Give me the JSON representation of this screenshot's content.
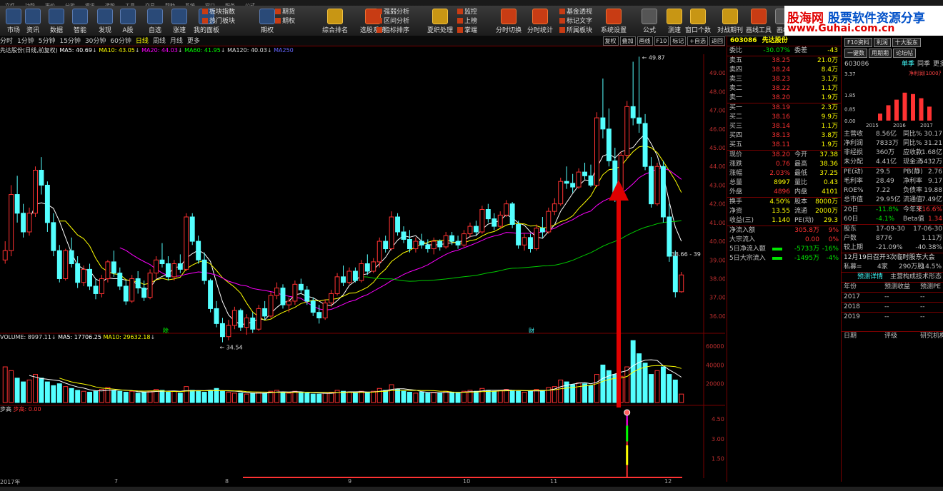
{
  "menubar": {
    "items": [
      "文件",
      "功能",
      "报价",
      "分析",
      "资讯",
      "选股",
      "工具",
      "交易",
      "帮助",
      "系统",
      "窗口",
      "服务",
      "公式"
    ]
  },
  "toolbar": {
    "buttons": [
      "市场",
      "资讯",
      "数据",
      "智能",
      "发现",
      "A股",
      "自选",
      "涨速",
      "我的面板",
      "期权",
      "综合排名",
      "选股系统",
      "夏织处理",
      "分时切换",
      "分时统计",
      "系统设置",
      "公式",
      "测速",
      "窗口个数",
      "对战期刊",
      "画线工具",
      "画线"
    ],
    "small_groups": [
      [
        "板块指数",
        "热门板块"
      ],
      [
        "期货",
        "期权"
      ],
      [
        "强弱分析",
        "区间分析",
        "指标排序"
      ],
      [
        "监控",
        "上榜",
        "掌端"
      ],
      [
        "基金透视",
        "标记文字",
        "所属板块"
      ]
    ]
  },
  "logo": {
    "brand_a": "股海网",
    "brand_b": "股票软件资源分享",
    "url": "www.Guhai.com.cn"
  },
  "periodbar": {
    "items": [
      "分时",
      "1分钟",
      "5分钟",
      "15分钟",
      "30分钟",
      "60分钟",
      "日线",
      "周线",
      "月线",
      "更多"
    ],
    "active": "日线",
    "right_buttons": [
      "复权",
      "叠加",
      "画线",
      "F10",
      "标记",
      "+自选",
      "返回"
    ]
  },
  "chart_legend": {
    "title": "先达股份(日线,前复权)",
    "ma5": "MA5: 40.69",
    "ma10": "MA10: 43.05",
    "ma20": "MA20: 44.03",
    "ma60": "MA60: 41.95",
    "ma120": "MA120: 40.03",
    "ma250": "MA250"
  },
  "volume_legend": {
    "label": "VOLUME: 8997.11",
    "ma5": "MA5: 17706.25",
    "ma10": "MA10: 29632.18"
  },
  "indicator_legend": {
    "name": "步高",
    "value": "步高: 0.00"
  },
  "price_annotations": {
    "high": "49.87",
    "low": "34.54",
    "last": "38.66 - 39",
    "mark_a": "除",
    "mark_b": "财"
  },
  "price_axis": [
    "49.00",
    "48.00",
    "47.00",
    "46.00",
    "45.00",
    "44.00",
    "43.00",
    "42.00",
    "41.00",
    "40.00",
    "39.00",
    "38.00",
    "37.00",
    "36.00"
  ],
  "volume_axis": [
    "60000",
    "40000",
    "20000"
  ],
  "indicator_axis": [
    "4.50",
    "3.00",
    "1.50"
  ],
  "time_axis": [
    "2017年",
    "7",
    "8",
    "9",
    "10",
    "11",
    "12"
  ],
  "quote": {
    "code": "603086",
    "name": "先达股份",
    "weibi_label": "委比",
    "weibi": "-30.07%",
    "weicha_label": "委差",
    "weicha": "-43",
    "asks": [
      {
        "label": "卖五",
        "price": "38.25",
        "vol": "21.0万"
      },
      {
        "label": "卖四",
        "price": "38.24",
        "vol": "8.4万"
      },
      {
        "label": "卖三",
        "price": "38.23",
        "vol": "3.1万"
      },
      {
        "label": "卖二",
        "price": "38.22",
        "vol": "1.1万"
      },
      {
        "label": "卖一",
        "price": "38.20",
        "vol": "1.9万"
      }
    ],
    "bids": [
      {
        "label": "买一",
        "price": "38.19",
        "vol": "2.3万"
      },
      {
        "label": "买二",
        "price": "38.16",
        "vol": "9.9万"
      },
      {
        "label": "买三",
        "price": "38.14",
        "vol": "1.1万"
      },
      {
        "label": "买四",
        "price": "38.13",
        "vol": "3.8万"
      },
      {
        "label": "买五",
        "price": "38.11",
        "vol": "1.9万"
      }
    ],
    "stats": [
      {
        "l1": "现价",
        "v1": "38.20",
        "l2": "今开",
        "v2": "37.38"
      },
      {
        "l1": "涨跌",
        "v1": "0.76",
        "l2": "最高",
        "v2": "38.36"
      },
      {
        "l1": "涨幅",
        "v1": "2.03%",
        "l2": "最低",
        "v2": "37.25"
      },
      {
        "l1": "总量",
        "v1": "8997",
        "l2": "量比",
        "v2": "0.43"
      },
      {
        "l1": "外盘",
        "v1": "4896",
        "l2": "内盘",
        "v2": "4101"
      }
    ],
    "stats2": [
      {
        "l1": "换手",
        "v1": "4.50%",
        "l2": "股本",
        "v2": "8000万"
      },
      {
        "l1": "净资",
        "v1": "13.55",
        "l2": "流通",
        "v2": "2000万"
      },
      {
        "l1": "收益(三)",
        "v1": "1.140",
        "l2": "PE(动)",
        "v2": "29.3"
      }
    ],
    "flows": [
      {
        "label": "净流入额",
        "v": "305.8万",
        "p": "9%"
      },
      {
        "label": "大宗流入",
        "v": "0.00",
        "p": "0%"
      },
      {
        "label": "5日净流入额",
        "v": "-5733万",
        "p": "-16%"
      },
      {
        "label": "5日大宗流入",
        "v": "-1495万",
        "p": "-4%"
      }
    ]
  },
  "f10": {
    "buttons": [
      "F10资料",
      "利润",
      "十大股东",
      "一键数",
      "用期期",
      "论坛帖"
    ],
    "code": "603086",
    "tab_a": "单季",
    "tab_b": "同季",
    "tab_c": "更多",
    "chart_ymax": "3.37",
    "chart_ticks": [
      "3.37",
      "1.85",
      "0.85",
      "0.00"
    ],
    "chart_legend": "净利润(1000万)",
    "years": [
      "2015",
      "2016",
      "2017"
    ],
    "bar_values": [
      0,
      0,
      0.5,
      1.1,
      1.5,
      2.0,
      1.9,
      1.6,
      1.0
    ],
    "rows": [
      {
        "a": "主营收",
        "b": "8.56亿",
        "c": "同比%",
        "d": "30.17"
      },
      {
        "a": "净利润",
        "b": "7833万",
        "c": "同比%",
        "d": "31.21"
      },
      {
        "a": "非经损",
        "b": "360万",
        "c": "应收款",
        "d": "1.68亿"
      },
      {
        "a": "未分配",
        "b": "4.41亿",
        "c": "现金流",
        "d": "5432万"
      },
      {
        "a": "PE(动)",
        "b": "29.5",
        "c": "PB(静)",
        "d": "2.76"
      },
      {
        "a": "毛利率",
        "b": "28.49",
        "c": "净利率",
        "d": "9.17"
      },
      {
        "a": "ROE%",
        "b": "7.22",
        "c": "负债率",
        "d": "19.88"
      },
      {
        "a": "总市值",
        "b": "29.95亿",
        "c": "流通值",
        "d": "7.49亿"
      },
      {
        "a": "20日",
        "b": "-11.8%",
        "c": "今年来",
        "d": "116.6%"
      },
      {
        "a": "60日",
        "b": "-4.1%",
        "c": "Beta值",
        "d": "1.34"
      },
      {
        "a": "股东",
        "b": "17-09-30",
        "c": "",
        "d": "17-06-30"
      },
      {
        "a": "户数",
        "b": "8776",
        "c": "",
        "d": "1.11万"
      },
      {
        "a": "较上期",
        "b": "-21.09%",
        "c": "",
        "d": "-40.38%"
      }
    ],
    "notice": "12月19日召开3次临时股东大会",
    "private": {
      "a": "私募=",
      "b": "4家",
      "c": "290万股",
      "d": "14.5%"
    },
    "tabs": [
      "预测详情",
      "主营构成",
      "技术形态"
    ],
    "forecast_header": [
      "年份",
      "预测收益",
      "预测PE"
    ],
    "forecast_rows": [
      [
        "2017",
        "--",
        "--"
      ],
      [
        "2018",
        "--",
        "--"
      ],
      [
        "2019",
        "--",
        "--"
      ]
    ],
    "date_header": [
      "日期",
      "评级",
      "研究机构"
    ]
  },
  "chart_data": {
    "type": "candlestick",
    "price_range": [
      35.5,
      50
    ],
    "candles": [
      [
        39,
        40,
        38.8,
        39.5
      ],
      [
        39.5,
        43,
        39.2,
        42.5
      ],
      [
        42.5,
        43.5,
        41,
        41.5
      ],
      [
        41.5,
        42,
        40.2,
        40.5
      ],
      [
        40.5,
        41.8,
        40.3,
        41.5
      ],
      [
        41.5,
        44,
        41.3,
        43.8
      ],
      [
        43.8,
        44.5,
        42.5,
        43
      ],
      [
        43,
        43.2,
        40.5,
        41
      ],
      [
        41,
        41.5,
        39.2,
        39.5
      ],
      [
        39.5,
        39.8,
        37.8,
        38
      ],
      [
        38,
        39.6,
        37.9,
        39.5
      ],
      [
        39.5,
        40.2,
        38.6,
        38.8
      ],
      [
        38.8,
        39.2,
        37.5,
        37.8
      ],
      [
        37.8,
        38.7,
        37.6,
        38.5
      ],
      [
        38.5,
        38.8,
        37.4,
        37.6
      ],
      [
        37.6,
        38,
        36.9,
        37.2
      ],
      [
        37.2,
        38.2,
        37,
        38
      ],
      [
        38,
        39,
        37.8,
        38.9
      ],
      [
        38.9,
        39.5,
        38.1,
        38.3
      ],
      [
        38.3,
        38.6,
        37.4,
        37.6
      ],
      [
        37.6,
        37.9,
        36.6,
        36.8
      ],
      [
        36.8,
        38.2,
        36.7,
        38
      ],
      [
        38,
        38.4,
        37.2,
        37.5
      ],
      [
        37.5,
        37.9,
        36.8,
        37
      ],
      [
        37,
        38.5,
        36.9,
        38.3
      ],
      [
        38.3,
        39.2,
        38,
        39
      ],
      [
        39,
        39.9,
        38.6,
        38.8
      ],
      [
        38.8,
        39.2,
        37.9,
        38.1
      ],
      [
        38.1,
        39,
        37.9,
        38.8
      ],
      [
        38.8,
        39.3,
        38.3,
        38.5
      ],
      [
        38.5,
        41.5,
        38.4,
        41.3
      ],
      [
        41.3,
        41.5,
        39.8,
        40
      ],
      [
        40,
        40.3,
        38.8,
        39
      ],
      [
        39,
        39.4,
        37.7,
        37.9
      ],
      [
        37.9,
        38,
        36.2,
        36.4
      ],
      [
        36.4,
        36.8,
        35.4,
        35.6
      ],
      [
        35.6,
        35.9,
        34.6,
        34.9
      ],
      [
        34.9,
        35.8,
        34.7,
        35.5
      ],
      [
        35.5,
        36.5,
        35.3,
        36.3
      ],
      [
        36.3,
        36.4,
        35.2,
        35.4
      ],
      [
        35.4,
        36.1,
        35,
        35.9
      ],
      [
        35.9,
        36.2,
        35.1,
        35.3
      ],
      [
        35.3,
        36.6,
        35.2,
        36.4
      ],
      [
        36.4,
        36.8,
        35.8,
        36
      ],
      [
        36,
        37.3,
        35.9,
        37.1
      ],
      [
        37.1,
        37.8,
        36.9,
        37.5
      ],
      [
        37.5,
        37.7,
        36.4,
        36.6
      ],
      [
        36.6,
        37,
        36.2,
        36.8
      ],
      [
        36.8,
        37.9,
        36.6,
        37.7
      ],
      [
        37.7,
        38,
        37.2,
        37.4
      ],
      [
        37.4,
        37.6,
        36.6,
        36.8
      ],
      [
        36.8,
        37,
        36,
        36.2
      ],
      [
        36.2,
        36.6,
        35.6,
        35.9
      ],
      [
        35.9,
        36.9,
        35.8,
        36.7
      ],
      [
        36.7,
        37.4,
        36.5,
        37.2
      ],
      [
        37.2,
        38.3,
        37.1,
        38.1
      ],
      [
        38.1,
        38.7,
        37.6,
        37.8
      ],
      [
        37.8,
        38.6,
        37.7,
        38.4
      ],
      [
        38.4,
        38.6,
        37.8,
        37.9
      ],
      [
        37.9,
        39,
        37.8,
        38.8
      ],
      [
        38.8,
        39.3,
        38.2,
        38.4
      ],
      [
        38.4,
        39.1,
        38.3,
        38.9
      ],
      [
        38.9,
        40.2,
        38.6,
        40
      ],
      [
        40,
        40.3,
        39.4,
        39.6
      ],
      [
        39.6,
        41.6,
        39.5,
        41.3
      ],
      [
        41.3,
        41.5,
        40.3,
        40.5
      ],
      [
        40.5,
        40.8,
        39.9,
        40.1
      ],
      [
        40.1,
        40.6,
        39.4,
        39.6
      ],
      [
        39.6,
        40.2,
        39.4,
        40
      ],
      [
        40,
        40.4,
        39.6,
        39.8
      ],
      [
        39.8,
        40.1,
        39.4,
        39.6
      ],
      [
        39.6,
        40.2,
        39.3,
        40
      ],
      [
        40,
        40.1,
        39.5,
        39.7
      ],
      [
        39.7,
        40.5,
        39.6,
        40.3
      ],
      [
        40.3,
        40.5,
        39.8,
        40
      ],
      [
        40,
        40.3,
        39.6,
        39.8
      ],
      [
        39.8,
        40.6,
        39.7,
        40.4
      ],
      [
        40.4,
        41,
        40.2,
        40.8
      ],
      [
        40.8,
        41.1,
        40.3,
        40.5
      ],
      [
        40.5,
        41.9,
        40.4,
        41.7
      ],
      [
        41.7,
        42,
        41,
        41.2
      ],
      [
        41.2,
        41.5,
        40.6,
        40.8
      ],
      [
        40.8,
        41.6,
        40.7,
        41.4
      ],
      [
        41.4,
        42.2,
        41.3,
        42
      ],
      [
        42,
        42.1,
        40.7,
        40.9
      ],
      [
        40.9,
        41.1,
        39.6,
        39.8
      ],
      [
        39.8,
        40.4,
        39.5,
        40.2
      ],
      [
        40.2,
        40.4,
        39.4,
        39.6
      ],
      [
        39.6,
        40.9,
        39.5,
        40.7
      ],
      [
        40.7,
        41.3,
        40.2,
        40.5
      ],
      [
        40.5,
        41.8,
        40.4,
        41.6
      ],
      [
        41.6,
        42.3,
        41.4,
        42
      ],
      [
        42,
        43.4,
        41.9,
        43.2
      ],
      [
        43.2,
        44,
        42.8,
        43.1
      ],
      [
        43.1,
        43.6,
        42.6,
        42.9
      ],
      [
        42.9,
        43.9,
        42.8,
        43.7
      ],
      [
        43.7,
        44.2,
        43.3,
        43.5
      ],
      [
        43.5,
        44.1,
        42.9,
        43
      ],
      [
        43,
        46.9,
        42.9,
        46.6
      ],
      [
        46.6,
        48.7,
        45.5,
        46
      ],
      [
        46,
        47.1,
        44,
        44.3
      ],
      [
        44.3,
        45,
        42.1,
        42.4
      ],
      [
        42.4,
        44.8,
        42.3,
        44.6
      ],
      [
        44.6,
        47.5,
        44.4,
        47.2
      ],
      [
        47.2,
        49.6,
        46.2,
        46.6
      ],
      [
        46.6,
        49.87,
        45.8,
        46.3
      ],
      [
        46.3,
        46.8,
        43.8,
        44
      ],
      [
        44,
        44.5,
        41.8,
        42
      ],
      [
        42,
        44.2,
        41.9,
        44
      ],
      [
        44,
        44.3,
        41,
        41.3
      ],
      [
        41.3,
        42,
        38.9,
        39.2
      ],
      [
        39.2,
        39.5,
        37,
        37.3
      ],
      [
        37.3,
        38.36,
        37.25,
        38.2
      ]
    ],
    "volume_range": [
      0,
      70000
    ],
    "volumes": [
      38000,
      34000,
      26000,
      22000,
      24000,
      30000,
      26000,
      22000,
      18000,
      20000,
      17000,
      15000,
      13000,
      12000,
      11000,
      12000,
      14000,
      16000,
      13000,
      12000,
      11000,
      12000,
      10000,
      11000,
      12000,
      14000,
      13000,
      11000,
      12000,
      10000,
      17000,
      13000,
      12000,
      11000,
      13000,
      15000,
      12000,
      11000,
      10000,
      10000,
      9000,
      10000,
      11000,
      10000,
      12000,
      13000,
      11000,
      10000,
      12000,
      11000,
      10000,
      9000,
      9000,
      10000,
      11000,
      13000,
      12000,
      11000,
      10000,
      12000,
      11000,
      12000,
      15000,
      13000,
      19000,
      14000,
      12000,
      11000,
      10000,
      11000,
      10000,
      11000,
      10000,
      12000,
      11000,
      10000,
      12000,
      13000,
      12000,
      15000,
      13000,
      12000,
      13000,
      14000,
      13000,
      12000,
      11000,
      12000,
      14000,
      13000,
      16000,
      17000,
      24000,
      22000,
      19000,
      21000,
      20000,
      18000,
      30000,
      40000,
      34000,
      30000,
      28000,
      38000,
      66000,
      52000,
      42000,
      30000,
      34000,
      38000,
      30000,
      24000,
      8997
    ],
    "indicator_range": [
      0,
      5
    ],
    "indicator_spike_index": 103,
    "indicator_spike_value": 5
  }
}
